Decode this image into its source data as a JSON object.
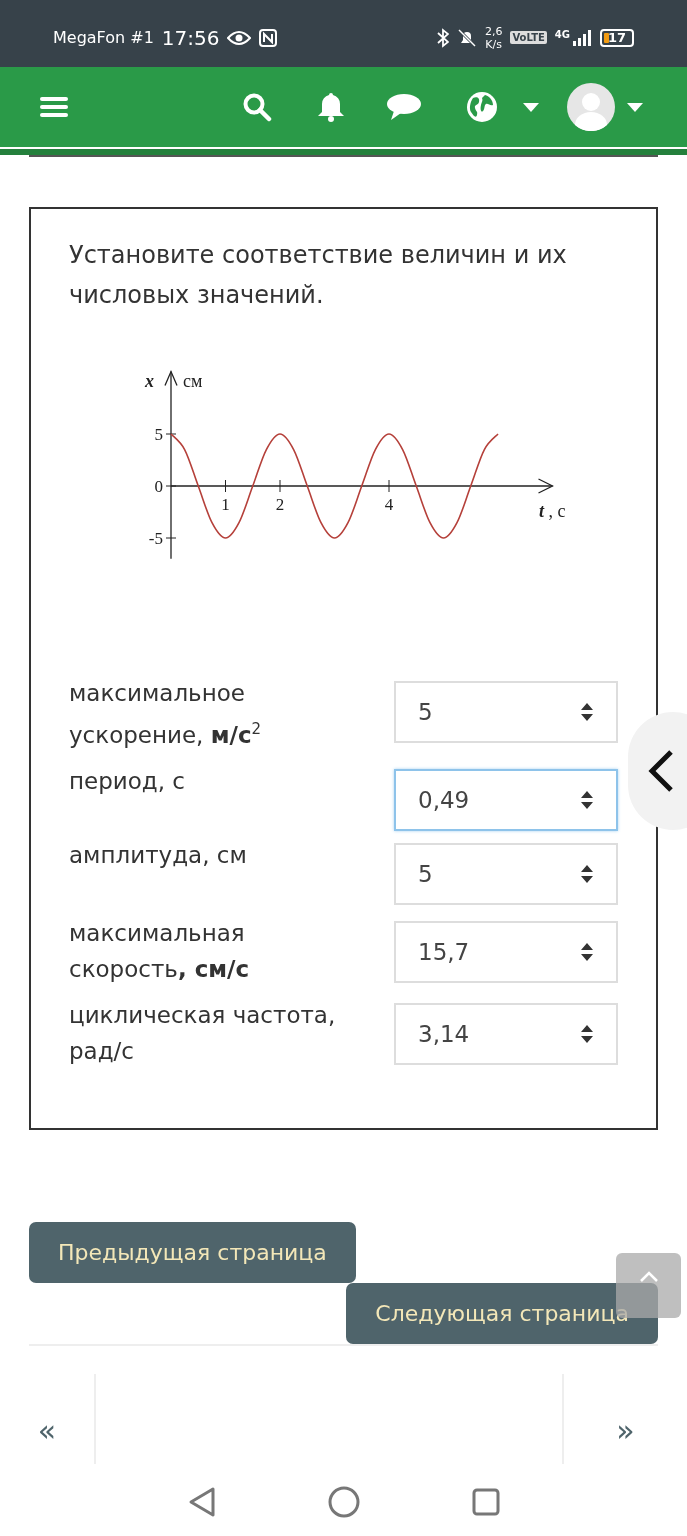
{
  "status_bar": {
    "carrier": "MegaFon #1",
    "time": "17:56",
    "speed_value": "2,6",
    "speed_unit": "K/s",
    "volte": "VoLTE",
    "network": "4G",
    "battery": "17"
  },
  "question": {
    "text": "Установите соответствие величин и их числовых значений.",
    "figure": {
      "y_unit": "см",
      "chart_data": {
        "type": "line",
        "ylabel": "x",
        "xlim": [
          0,
          7
        ],
        "ylim": [
          -7,
          11
        ],
        "annotations": [
          {
            "text": "**t** , с"
          }
        ],
        "x": [
          0,
          0.25,
          0.5,
          0.75,
          1,
          1.25,
          1.5,
          1.75,
          2,
          2.25,
          2.5,
          2.75,
          3,
          3.25,
          3.5,
          3.75,
          4,
          4.25,
          4.5,
          4.75,
          5,
          5.25,
          5.5,
          5.75,
          6
        ],
        "series": [
          {
            "color": "#b5403a",
            "values": [
              5,
              3.5,
              0,
              -3.5,
              -5,
              -3.5,
              0,
              3.5,
              5,
              3.5,
              0,
              -3.5,
              -5,
              -3.5,
              0,
              3.5,
              5,
              3.5,
              0,
              -3.5,
              -5,
              -3.5,
              0,
              3.5,
              5
            ]
          }
        ],
        "xticks": [
          1,
          2,
          4
        ],
        "yticks": [
          5,
          0,
          -5
        ]
      }
    },
    "rows": [
      {
        "label": "максимальное ускорение, **м/с**$^{2}$",
        "value": "5",
        "focused": false
      },
      {
        "label": "период, с",
        "value": "0,49",
        "focused": true
      },
      {
        "label": "амплитуда, см",
        "value": "5",
        "focused": false
      },
      {
        "label": "максимальная скорость**, см/с**",
        "value": "15,7",
        "focused": false
      },
      {
        "label": "циклическая частота, рад/с",
        "value": "3,14",
        "focused": false
      }
    ]
  },
  "buttons": {
    "previous": "Предыдущая страница",
    "next": "Следующая страница"
  },
  "pager": {
    "first": "«",
    "last": "»"
  }
}
